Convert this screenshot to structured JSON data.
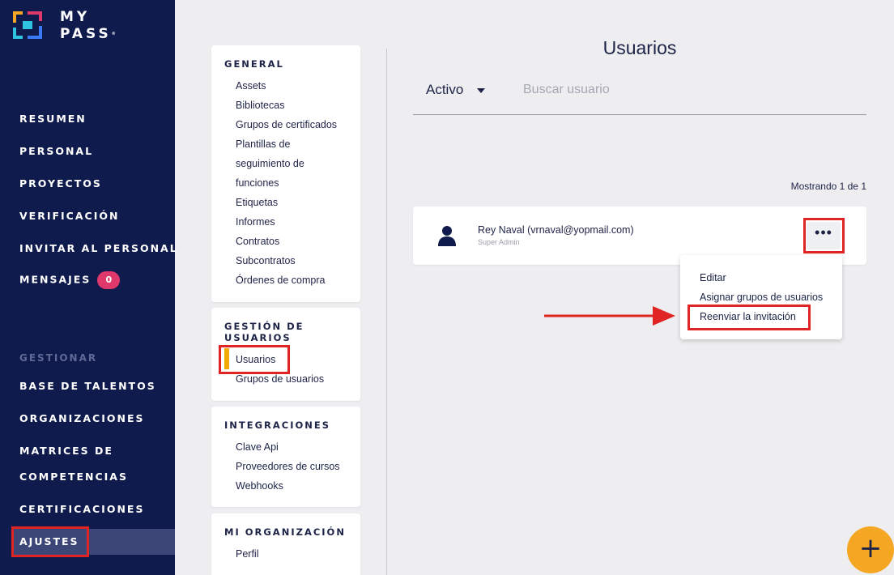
{
  "brand": {
    "line1": "MY",
    "line2": "PASS",
    "mark": "®"
  },
  "sidebar": {
    "items": [
      {
        "label": "RESUMEN"
      },
      {
        "label": "PERSONAL"
      },
      {
        "label": "PROYECTOS"
      },
      {
        "label": "VERIFICACIÓN"
      },
      {
        "label": "INVITAR AL PERSONAL"
      },
      {
        "label": "MENSAJES",
        "badge": "0"
      }
    ],
    "section": "GESTIONAR",
    "manage_items": [
      {
        "label": "BASE DE TALENTOS"
      },
      {
        "label": "ORGANIZACIONES"
      },
      {
        "label": "MATRICES DE"
      },
      {
        "label": "COMPETENCIAS"
      },
      {
        "label": "CERTIFICACIONES"
      },
      {
        "label": "AJUSTES"
      }
    ]
  },
  "settings": {
    "general": {
      "title": "GENERAL",
      "links": [
        "Assets",
        "Bibliotecas",
        "Grupos de certificados",
        "Plantillas de",
        "seguimiento de",
        "funciones",
        "Etiquetas",
        "Informes",
        "Contratos",
        "Subcontratos",
        "Órdenes de compra"
      ]
    },
    "users": {
      "title_line1": "GESTIÓN DE",
      "title_line2": "USUARIOS",
      "links": [
        "Usuarios",
        "Grupos de usuarios"
      ]
    },
    "integrations": {
      "title": "INTEGRACIONES",
      "links": [
        "Clave Api",
        "Proveedores de cursos",
        "Webhooks"
      ]
    },
    "org": {
      "title": "MI ORGANIZACIÓN",
      "links": [
        "Perfil"
      ]
    }
  },
  "main": {
    "title": "Usuarios",
    "status_filter": "Activo",
    "search_placeholder": "Buscar usuario",
    "showing": "Mostrando 1 de 1",
    "user": {
      "name": "Rey Naval (vrnaval@yopmail.com)",
      "role": "Super Admin"
    },
    "more_label": "•••",
    "menu": [
      "Editar",
      "Asignar grupos de usuarios",
      "Reenviar la invitación"
    ],
    "fab_label": "+"
  },
  "colors": {
    "sidebar": "#0f1a4d",
    "accent": "#f5a623",
    "highlight": "#e02424",
    "badge": "#e0386b"
  },
  "icons": [
    "mypass-logo-icon",
    "user-icon",
    "more-icon",
    "arrow-icon",
    "plus-icon",
    "caret-down-icon"
  ]
}
